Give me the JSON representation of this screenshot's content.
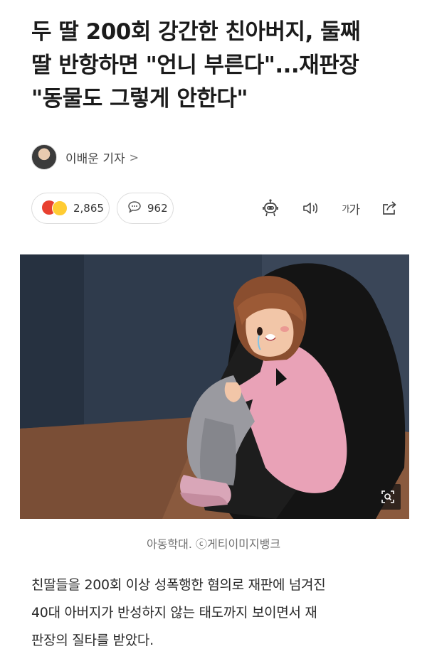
{
  "article": {
    "headline_lines": [
      "두 딸 200회 강간한 친아버지, 둘째",
      "딸 반항하면 \"언니 부른다\"...재판장",
      "\"동물도 그렇게 안한다\""
    ],
    "reporter": "이배운 기자",
    "reporter_chevron": ">",
    "reaction_count": "2,865",
    "comment_count": "962",
    "fontsize_label_small": "가",
    "fontsize_label_large": "가",
    "image_caption": "아동학대. ⓒ게티이미지뱅크",
    "body_lines": [
      "친딸들을 200회 이상 성폭행한 혐의로 재판에 넘겨진",
      "40대 아버지가 반성하지 않는 태도까지 보이면서 재",
      "판장의 질타를 받았다."
    ]
  },
  "icons": {
    "reaction": "angry-and-happy-emoji-icon",
    "comment": "speech-bubble-icon",
    "ai_summary": "robot-icon",
    "tts": "speaker-icon",
    "font_size": "font-size-icon",
    "share": "share-icon",
    "zoom": "zoom-icon"
  },
  "colors": {
    "wall": "#2f3b4c",
    "floor": "#8a5a3e",
    "sweater": "#e9a2b7",
    "reaction_angry": "#e8402f",
    "reaction_happy": "#ffcc33"
  }
}
